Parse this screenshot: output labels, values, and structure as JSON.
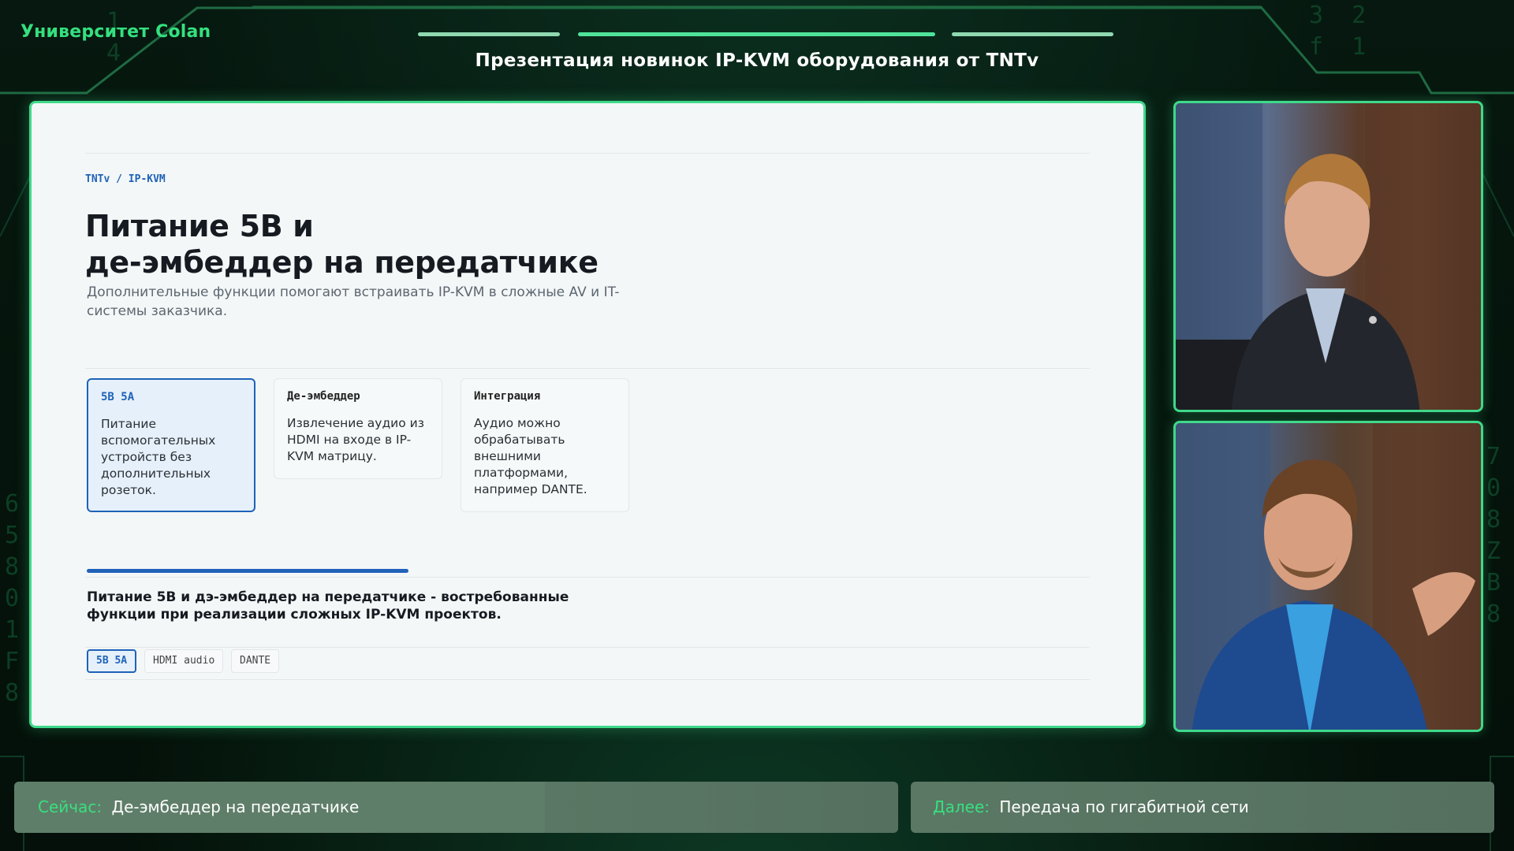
{
  "header": {
    "brand": "Университет Colan",
    "title": "Презентация новинок IP-KVM оборудования от TNTv"
  },
  "slide": {
    "breadcrumb": "TNTv / IP-KVM",
    "title_line1": "Питание 5В и",
    "title_line2": "де-эмбеддер на передатчике",
    "subtitle": "Дополнительные функции помогают встраивать IP-KVM в сложные AV и IT-системы заказчика.",
    "cards": [
      {
        "title": "5В 5А",
        "body": "Питание вспомогательных устройств без дополнительных розеток.",
        "active": true
      },
      {
        "title": "Де-эмбеддер",
        "body": "Извлечение аудио из HDMI на входе в IP-KVM матрицу.",
        "active": false
      },
      {
        "title": "Интеграция",
        "body": "Аудио можно обрабатывать внешними платформами, например DANTE.",
        "active": false
      }
    ],
    "summary": "Питание 5В и дэ-эмбеддер на передатчике - востребованные функции при реализации сложных IP-KVM проектов.",
    "tags": [
      "5В 5А",
      "HDMI audio",
      "DANTE"
    ]
  },
  "lower_third": {
    "now_key": "Сейчас:",
    "now_value": "Де-эмбеддер на передатчике",
    "now_progress": 0.6,
    "next_key": "Далее:",
    "next_value": "Передача по гигабитной сети"
  },
  "colors": {
    "accent_green": "#3fd98a",
    "accent_blue": "#1f62b8",
    "background": "#04130c"
  }
}
